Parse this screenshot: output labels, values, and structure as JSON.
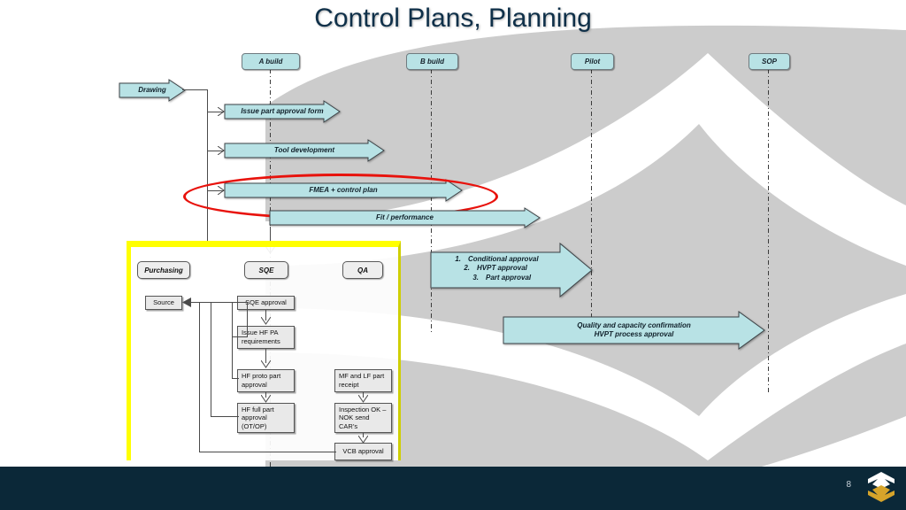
{
  "slide": {
    "title": "Control Plans, Planning",
    "page_number": "8",
    "logo_name": "company-hex-logo"
  },
  "colors": {
    "arrow_fill": "#b8e2e5",
    "arrow_stroke": "#3d4347",
    "title_text": "#0f3049",
    "highlight_ellipse": "#e8120c",
    "panel_border": "#ffff00",
    "footer_bg": "#0b2838",
    "background_decor": "#cccccc",
    "box_fill": "#e9e9e9"
  },
  "milestones": [
    {
      "label": "A build"
    },
    {
      "label": "B build"
    },
    {
      "label": "Pilot"
    },
    {
      "label": "SOP"
    }
  ],
  "entry": {
    "label": "Drawing"
  },
  "timeline_arrows": [
    {
      "label": "Issue part approval form"
    },
    {
      "label": "Tool development"
    },
    {
      "label": "FMEA + control plan"
    },
    {
      "label": "Fit / performance"
    }
  ],
  "approval_arrow": {
    "items": [
      {
        "num": "1.",
        "label": "Conditional approval"
      },
      {
        "num": "2.",
        "label": "HVPT approval"
      },
      {
        "num": "3.",
        "label": "Part approval"
      }
    ]
  },
  "quality_arrow": {
    "line1": "Quality and  capacity confirmation",
    "line2": "HVPT process approval"
  },
  "swimlanes": [
    {
      "label": "Purchasing"
    },
    {
      "label": "SQE"
    },
    {
      "label": "QA"
    }
  ],
  "process_boxes": {
    "purchasing": [
      {
        "label": "Source"
      }
    ],
    "sqe": [
      {
        "label": "SQE approval"
      },
      {
        "label": "Issue HF PA requirements"
      },
      {
        "label": "HF proto part approval"
      },
      {
        "label": "HF full part approval (OT/OP)"
      }
    ],
    "qa": [
      {
        "label": "MF and LF part receipt"
      },
      {
        "label": "Inspection OK – NOK send CAR’s"
      },
      {
        "label": "VCB approval"
      }
    ]
  }
}
